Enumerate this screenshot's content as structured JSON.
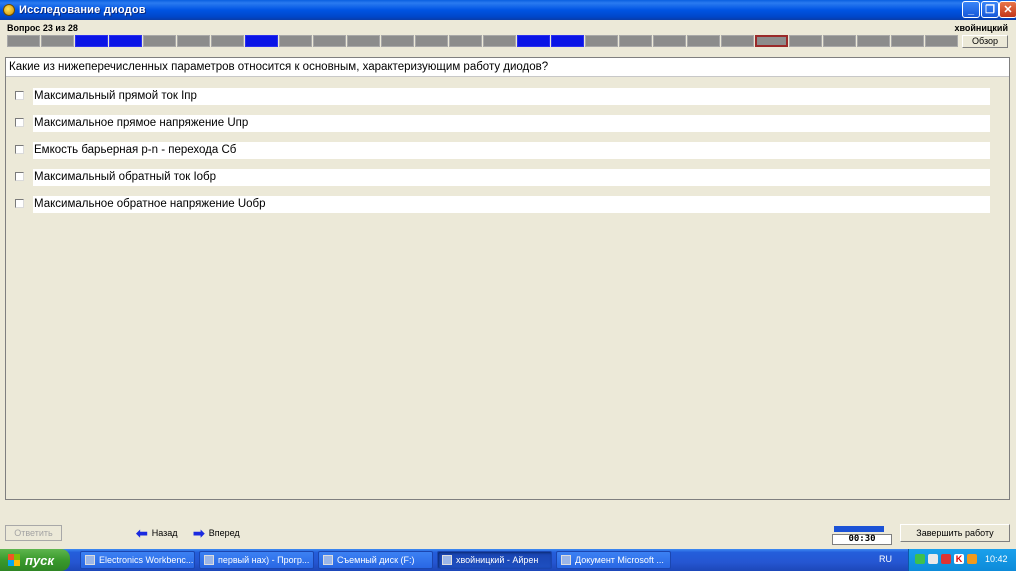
{
  "window": {
    "title": "Исследование диодов"
  },
  "header": {
    "question_counter": "Вопрос 23 из 28",
    "username": "хвойницкий",
    "review_label": "Обзор",
    "progress": {
      "total": 28,
      "answered": [
        3,
        4,
        8,
        16,
        17
      ],
      "current": 23
    }
  },
  "question": {
    "text": "Какие из нижеперечисленных параметров относится к основным, характеризующим работу диодов?",
    "options": [
      {
        "label": "Максимальный прямой ток Iпр",
        "checked": false
      },
      {
        "label": "Максимальное прямое напряжение Uпр",
        "checked": false
      },
      {
        "label": "Емкость барьерная p-n - перехода Сб",
        "checked": false
      },
      {
        "label": "Максимальный обратный ток Iобр",
        "checked": false
      },
      {
        "label": "Максимальное обратное напряжение Uобр",
        "checked": false
      }
    ]
  },
  "controls": {
    "answer_label": "Ответить",
    "back_label": "Назад",
    "forward_label": "Вперед",
    "timer": "00:30",
    "finish_label": "Завершить работу"
  },
  "taskbar": {
    "start_label": "пуск",
    "tasks": [
      {
        "label": "Electronics Workbenc...",
        "active": false
      },
      {
        "label": "первый нах) - Прогр...",
        "active": false
      },
      {
        "label": "Съемный диск (F:)",
        "active": false
      },
      {
        "label": "хвойницкий - Айрен",
        "active": true
      },
      {
        "label": "Документ Microsoft ...",
        "active": false
      }
    ],
    "language": "RU",
    "clock": "10:42"
  },
  "colors": {
    "answered": "#0A14E6",
    "unanswered": "#8C8C8C",
    "current_border": "#9A2A2A",
    "titlebar": "#0054E3"
  }
}
